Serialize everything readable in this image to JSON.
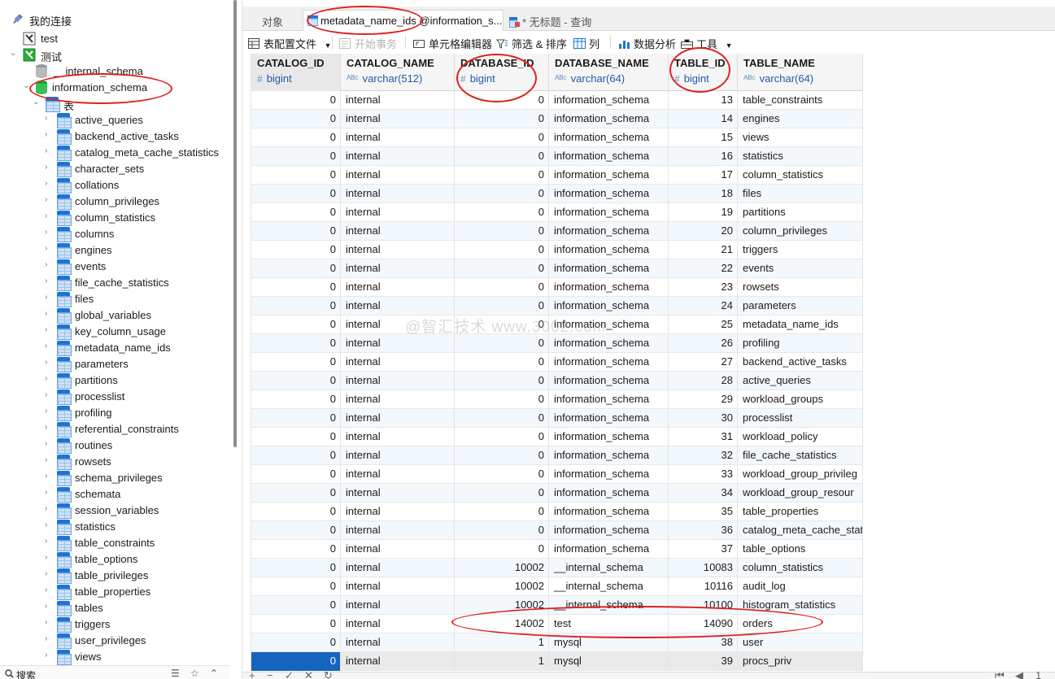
{
  "sidebar": {
    "header": "我的连接",
    "connections": [
      {
        "label": "test",
        "expanded": false
      },
      {
        "label": "测试",
        "expanded": true
      }
    ],
    "schemas": [
      {
        "label": "__internal_schema"
      },
      {
        "label": "information_schema",
        "expanded": true
      }
    ],
    "tables_group": "表",
    "tables": [
      "active_queries",
      "backend_active_tasks",
      "catalog_meta_cache_statistics",
      "character_sets",
      "collations",
      "column_privileges",
      "column_statistics",
      "columns",
      "engines",
      "events",
      "file_cache_statistics",
      "files",
      "global_variables",
      "key_column_usage",
      "metadata_name_ids",
      "parameters",
      "partitions",
      "processlist",
      "profiling",
      "referential_constraints",
      "routines",
      "rowsets",
      "schema_privileges",
      "schemata",
      "session_variables",
      "statistics",
      "table_constraints",
      "table_options",
      "table_privileges",
      "table_properties",
      "tables",
      "triggers",
      "user_privileges",
      "views"
    ],
    "search_label": "搜索"
  },
  "tabs": [
    {
      "label": "对象",
      "active": false
    },
    {
      "label": "metadata_name_ids @information_s...",
      "active": true
    },
    {
      "label": "* 无标题 - 查询",
      "active": false
    }
  ],
  "toolbar": {
    "table_config": "表配置文件",
    "begin_transaction": "开始事务",
    "cell_editor": "单元格编辑器",
    "filter_sort": "筛选 & 排序",
    "columns": "列",
    "data_analysis": "数据分析",
    "tools": "工具"
  },
  "grid": {
    "columns": [
      {
        "name": "CATALOG_ID",
        "type": "bigint",
        "type_icon": "#"
      },
      {
        "name": "CATALOG_NAME",
        "type": "varchar(512)",
        "type_icon": "ABC"
      },
      {
        "name": "DATABASE_ID",
        "type": "bigint",
        "type_icon": "#"
      },
      {
        "name": "DATABASE_NAME",
        "type": "varchar(64)",
        "type_icon": "ABC"
      },
      {
        "name": "TABLE_ID",
        "type": "bigint",
        "type_icon": "#"
      },
      {
        "name": "TABLE_NAME",
        "type": "varchar(64)",
        "type_icon": "ABC"
      }
    ],
    "rows": [
      [
        "0",
        "internal",
        "0",
        "information_schema",
        "13",
        "table_constraints"
      ],
      [
        "0",
        "internal",
        "0",
        "information_schema",
        "14",
        "engines"
      ],
      [
        "0",
        "internal",
        "0",
        "information_schema",
        "15",
        "views"
      ],
      [
        "0",
        "internal",
        "0",
        "information_schema",
        "16",
        "statistics"
      ],
      [
        "0",
        "internal",
        "0",
        "information_schema",
        "17",
        "column_statistics"
      ],
      [
        "0",
        "internal",
        "0",
        "information_schema",
        "18",
        "files"
      ],
      [
        "0",
        "internal",
        "0",
        "information_schema",
        "19",
        "partitions"
      ],
      [
        "0",
        "internal",
        "0",
        "information_schema",
        "20",
        "column_privileges"
      ],
      [
        "0",
        "internal",
        "0",
        "information_schema",
        "21",
        "triggers"
      ],
      [
        "0",
        "internal",
        "0",
        "information_schema",
        "22",
        "events"
      ],
      [
        "0",
        "internal",
        "0",
        "information_schema",
        "23",
        "rowsets"
      ],
      [
        "0",
        "internal",
        "0",
        "information_schema",
        "24",
        "parameters"
      ],
      [
        "0",
        "internal",
        "0",
        "information_schema",
        "25",
        "metadata_name_ids"
      ],
      [
        "0",
        "internal",
        "0",
        "information_schema",
        "26",
        "profiling"
      ],
      [
        "0",
        "internal",
        "0",
        "information_schema",
        "27",
        "backend_active_tasks"
      ],
      [
        "0",
        "internal",
        "0",
        "information_schema",
        "28",
        "active_queries"
      ],
      [
        "0",
        "internal",
        "0",
        "information_schema",
        "29",
        "workload_groups"
      ],
      [
        "0",
        "internal",
        "0",
        "information_schema",
        "30",
        "processlist"
      ],
      [
        "0",
        "internal",
        "0",
        "information_schema",
        "31",
        "workload_policy"
      ],
      [
        "0",
        "internal",
        "0",
        "information_schema",
        "32",
        "file_cache_statistics"
      ],
      [
        "0",
        "internal",
        "0",
        "information_schema",
        "33",
        "workload_group_privileg"
      ],
      [
        "0",
        "internal",
        "0",
        "information_schema",
        "34",
        "workload_group_resour"
      ],
      [
        "0",
        "internal",
        "0",
        "information_schema",
        "35",
        "table_properties"
      ],
      [
        "0",
        "internal",
        "0",
        "information_schema",
        "36",
        "catalog_meta_cache_stat"
      ],
      [
        "0",
        "internal",
        "0",
        "information_schema",
        "37",
        "table_options"
      ],
      [
        "0",
        "internal",
        "10002",
        "__internal_schema",
        "10083",
        "column_statistics"
      ],
      [
        "0",
        "internal",
        "10002",
        "__internal_schema",
        "10116",
        "audit_log"
      ],
      [
        "0",
        "internal",
        "10002",
        "__internal_schema",
        "10100",
        "histogram_statistics"
      ],
      [
        "0",
        "internal",
        "14002",
        "test",
        "14090",
        "orders"
      ],
      [
        "0",
        "internal",
        "1",
        "mysql",
        "38",
        "user"
      ],
      [
        "0",
        "internal",
        "1",
        "mysql",
        "39",
        "procs_priv"
      ]
    ],
    "selected_row": 30
  },
  "watermark": "@智汇技术 www.3002.com",
  "bottom_bar": {
    "page": "1"
  },
  "colors": {
    "accent": "#1565c0",
    "annotation": "#e02020",
    "header_bg": "#f5f5f5",
    "alt_row": "#f3f8fd"
  }
}
